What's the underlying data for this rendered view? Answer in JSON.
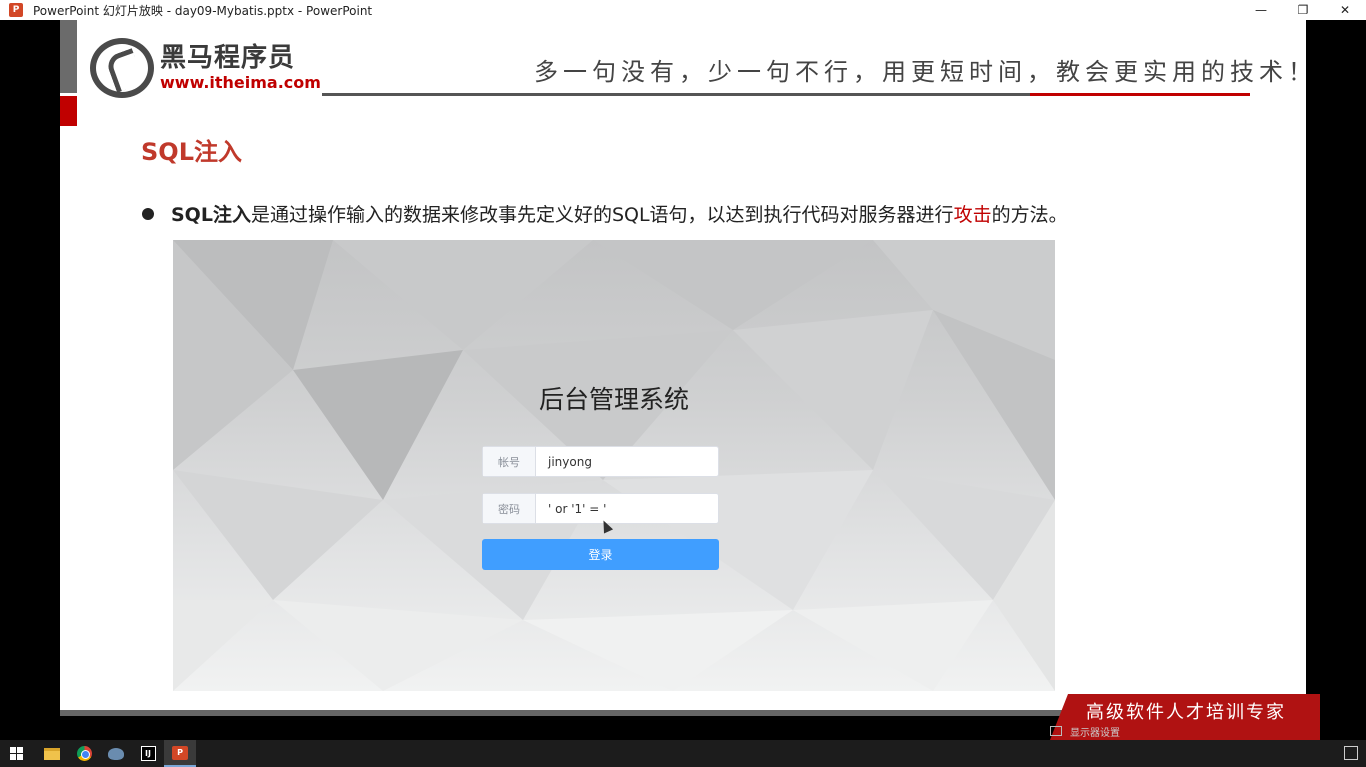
{
  "window": {
    "title": "PowerPoint 幻灯片放映  -  day09-Mybatis.pptx - PowerPoint",
    "app_icon": "P",
    "minimize_icon": "—",
    "restore_icon": "❐",
    "close_icon": "✕"
  },
  "slide": {
    "logo_cn": "黑马程序员",
    "logo_url": "www.itheima.com",
    "slogan": "多一句没有，少一句不行，用更短时间，教会更实用的技术！",
    "title": "SQL注入",
    "bullet": {
      "strong": "SQL注入",
      "text_before": "是通过操作输入的数据来修改事先定义好的SQL语句，以达到执行代码对服务器进行",
      "highlight": "攻击",
      "text_after": "的方法。"
    },
    "banner": "高级软件人才培训专家"
  },
  "login": {
    "title": "后台管理系统",
    "username_label": "帐号",
    "username_value": "jinyong",
    "password_label": "密码",
    "password_value": "' or '1' = '",
    "login_button": "登录"
  },
  "status": {
    "display_settings": "显示器设置"
  },
  "taskbar": {
    "idea_label": "IJ",
    "ppt_label": "P"
  },
  "colors": {
    "accent_red": "#c00000",
    "title_red": "#c0392b",
    "login_blue": "#409eff"
  }
}
